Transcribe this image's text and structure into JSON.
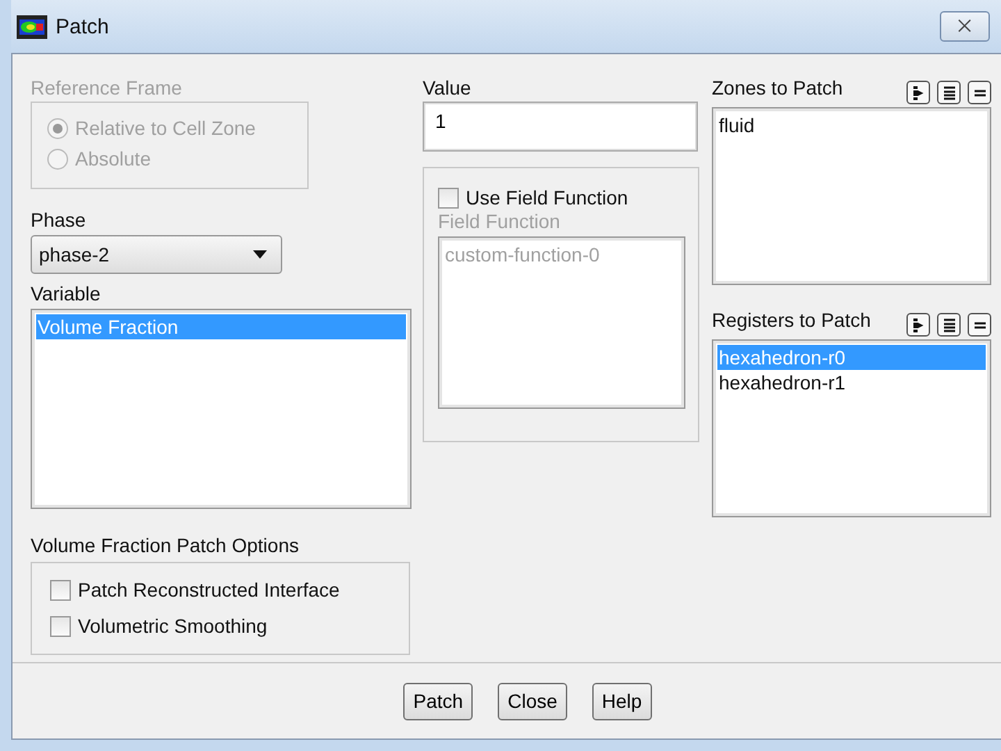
{
  "window": {
    "title": "Patch",
    "close": "⨉"
  },
  "reference_frame": {
    "label": "Reference Frame",
    "disabled": true,
    "options": [
      {
        "label": "Relative to Cell Zone",
        "selected": true
      },
      {
        "label": "Absolute",
        "selected": false
      }
    ]
  },
  "phase": {
    "label": "Phase",
    "value": "phase-2"
  },
  "variable": {
    "label": "Variable",
    "items": [
      {
        "label": "Volume Fraction",
        "selected": true
      }
    ]
  },
  "patch_options": {
    "label": "Volume Fraction Patch Options",
    "options": [
      {
        "label": "Patch Reconstructed Interface",
        "checked": false
      },
      {
        "label": "Volumetric Smoothing",
        "checked": false
      }
    ]
  },
  "value": {
    "label": "Value",
    "value": "1"
  },
  "field_function": {
    "checkbox": {
      "label": "Use Field Function",
      "checked": false
    },
    "label": "Field Function",
    "disabled": true,
    "items": [
      {
        "label": "custom-function-0",
        "selected": false
      }
    ]
  },
  "zones": {
    "label": "Zones to Patch",
    "items": [
      {
        "label": "fluid",
        "selected": false
      }
    ]
  },
  "registers": {
    "label": "Registers to Patch",
    "items": [
      {
        "label": "hexahedron-r0",
        "selected": true
      },
      {
        "label": "hexahedron-r1",
        "selected": false
      }
    ]
  },
  "buttons": [
    "Patch",
    "Close",
    "Help"
  ]
}
